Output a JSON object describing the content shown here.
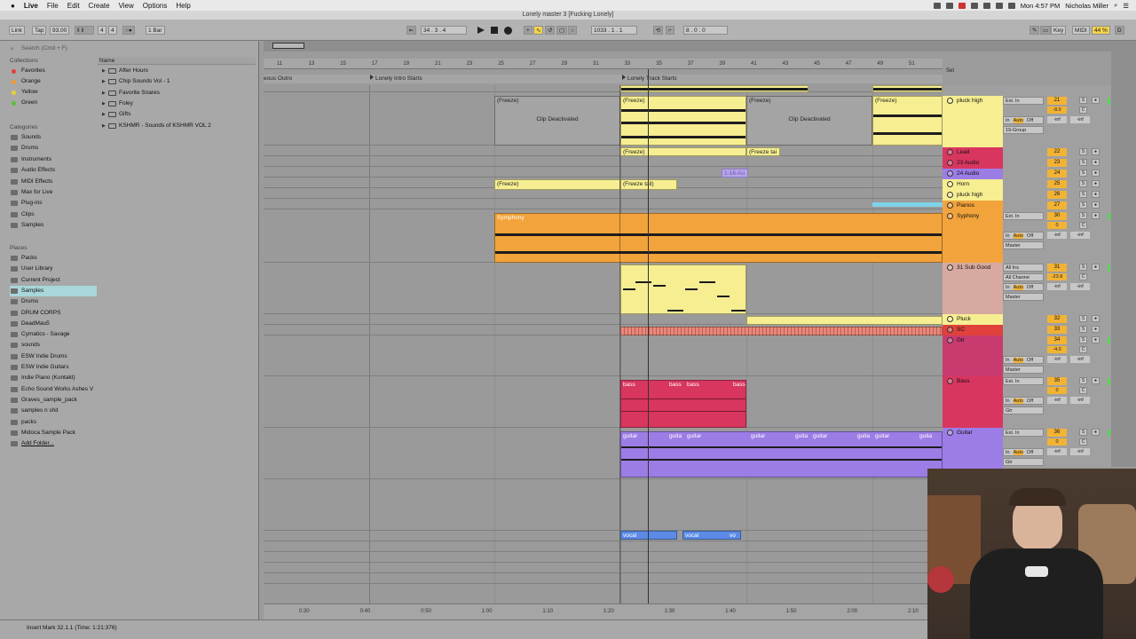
{
  "menubar": {
    "apple": "",
    "app": "Live",
    "items": [
      "File",
      "Edit",
      "Create",
      "View",
      "Options",
      "Help"
    ],
    "clock": "Mon 4:57 PM",
    "user": "Nicholas Miller"
  },
  "window": {
    "title": "Lonely master 3  [Fucking Lonely]"
  },
  "transport": {
    "link": "Link",
    "tap": "Tap",
    "tempo": "93.00",
    "sig_num": "4",
    "sig_den": "4",
    "quantize": "1 Bar",
    "arr_pos": "34 .  3 .  4",
    "loop_start": "1033 .  1 .  1",
    "loop_len": "8 .  0 .  0",
    "key": "Key",
    "midi": "MIDI",
    "cpu": "44 %"
  },
  "browser": {
    "search_placeholder": "Search (Cmd + F)",
    "collections_label": "Collections",
    "collections": [
      {
        "label": "Favorites",
        "color": "#e0413a"
      },
      {
        "label": "Orange",
        "color": "#f29a2e"
      },
      {
        "label": "Yellow",
        "color": "#e9d22d"
      },
      {
        "label": "Green",
        "color": "#5bbf3a"
      }
    ],
    "categories_label": "Categories",
    "categories": [
      "Sounds",
      "Drums",
      "Instruments",
      "Audio Effects",
      "MIDI Effects",
      "Max for Live",
      "Plug-ins",
      "Clips",
      "Samples"
    ],
    "places_label": "Places",
    "places": [
      "Packs",
      "User Library",
      "Current Project",
      "Samples",
      "Drums",
      "DRUM CORPS",
      "DeadMau5",
      "Cymatics - Savage",
      "sounds",
      "ESW Indie Drums",
      "ESW Indie Guitars",
      "Indie Piano (Kontakt)",
      "Echo Sound Works Ashes V",
      "Graves_sample_pack",
      "samples n shit",
      "packs",
      "Midoca Sample Pack",
      "Add Folder..."
    ],
    "name_header": "Name",
    "files": [
      "After Hours",
      "Chip Sounds Vol - 1",
      "Favorite Snares",
      "Foley",
      "Gifts",
      "KSHMR - Sounds of KSHMR VOL 2"
    ]
  },
  "status": "Insert Mark 32.1.1 (Time: 1:21:376)",
  "ruler": [
    "11",
    "13",
    "15",
    "17",
    "19",
    "21",
    "23",
    "25",
    "27",
    "29",
    "31",
    "33",
    "35",
    "37",
    "39",
    "41",
    "43",
    "45",
    "47",
    "49",
    "51"
  ],
  "locators": [
    "eous Outro",
    "Lonely Intro Starts",
    "Lonely Track Starts"
  ],
  "timeline": [
    "0:30",
    "0:40",
    "0:50",
    "1:00",
    "1:10",
    "1:20",
    "1:30",
    "1:40",
    "1:50",
    "2:00",
    "2:10"
  ],
  "clips": {
    "freeze": "(Freeze)",
    "freeze_tail": "(Freeze tail)",
    "freeze_tai": "(Freeze tai",
    "deactivated": "Clip Deactivated",
    "audio_small": "1-16-Au",
    "symphony": "Symphony",
    "bass": "bass",
    "guitar": "guitar",
    "guita": "guita",
    "vocal": "vocal",
    "vo": "vo"
  },
  "set_label": "Set",
  "tracks": [
    {
      "name": "pluck high",
      "color": "#f6ee91",
      "num": "21",
      "io": "Ext. In",
      "route": "19-Group",
      "vol": "-8.0"
    },
    {
      "name": "Lead",
      "color": "#d8365f",
      "num": "22"
    },
    {
      "name": "23 Audio",
      "color": "#d8365f",
      "num": "23"
    },
    {
      "name": "24 Audio",
      "color": "#9c7de6",
      "num": "24"
    },
    {
      "name": "Horn",
      "color": "#f6ee91",
      "num": "25"
    },
    {
      "name": "pluck high",
      "color": "#f6ee91",
      "num": "26"
    },
    {
      "name": "Pianos",
      "color": "#f2a33b",
      "num": "27"
    },
    {
      "name": "Syphony",
      "color": "#f2a33b",
      "num": "30",
      "io": "Ext. In",
      "route": "Master",
      "vol": "0"
    },
    {
      "name": "31 Sub Good",
      "color": "#d7a9a0",
      "num": "31",
      "io": "All Ins",
      "route": "Master",
      "vol": "-23.8",
      "chan": "All Channe"
    },
    {
      "name": "Pluck",
      "color": "#f6ee91",
      "num": "32"
    },
    {
      "name": "SC",
      "color": "#e0413a",
      "num": "33"
    },
    {
      "name": "Gtr",
      "color": "#c93a6f",
      "num": "34",
      "route": "Master",
      "vol": "-4.0"
    },
    {
      "name": "Bass",
      "color": "#d8365f",
      "num": "35",
      "io": "Ext. In",
      "route": "Gtr",
      "vol": "0"
    },
    {
      "name": "Guitar",
      "color": "#9c7de6",
      "num": "36",
      "io": "Ext. In",
      "route": "Gtr",
      "vol": "0"
    }
  ],
  "mixer": {
    "in": "In",
    "auto": "Auto",
    "off": "Off",
    "inf": "-inf",
    "s": "S",
    "c": "C"
  }
}
